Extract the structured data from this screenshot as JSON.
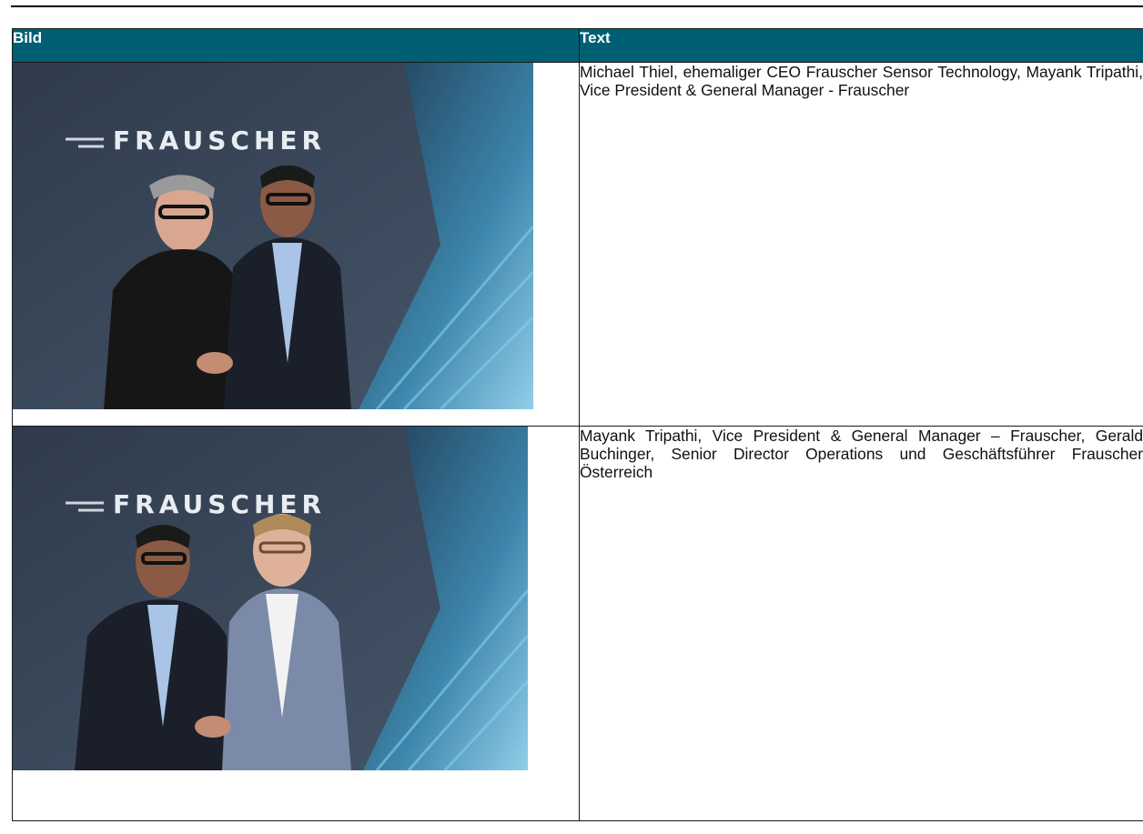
{
  "table": {
    "headers": [
      "Bild",
      "Text"
    ],
    "rows": [
      {
        "image": {
          "logo_text": "FRAUSCHER",
          "icon": "frauscher-logo-icon"
        },
        "caption": "Michael Thiel, ehemaliger CEO Frauscher Sensor Technology, Mayank Tripathi, Vice President & General Manager - Frauscher"
      },
      {
        "image": {
          "logo_text": "FRAUSCHER",
          "icon": "frauscher-logo-icon"
        },
        "caption": "Mayank Tripathi, Vice President & General Manager – Frauscher, Gerald Buchinger, Senior Director Operations und Geschäftsführer Frauscher Österreich"
      }
    ]
  },
  "colors": {
    "header_bg": "#005f73",
    "header_text": "#ffffff",
    "border": "#1a1a1a",
    "photo_wall": "#3d4a5c",
    "photo_glow": "#4fb3d9"
  }
}
